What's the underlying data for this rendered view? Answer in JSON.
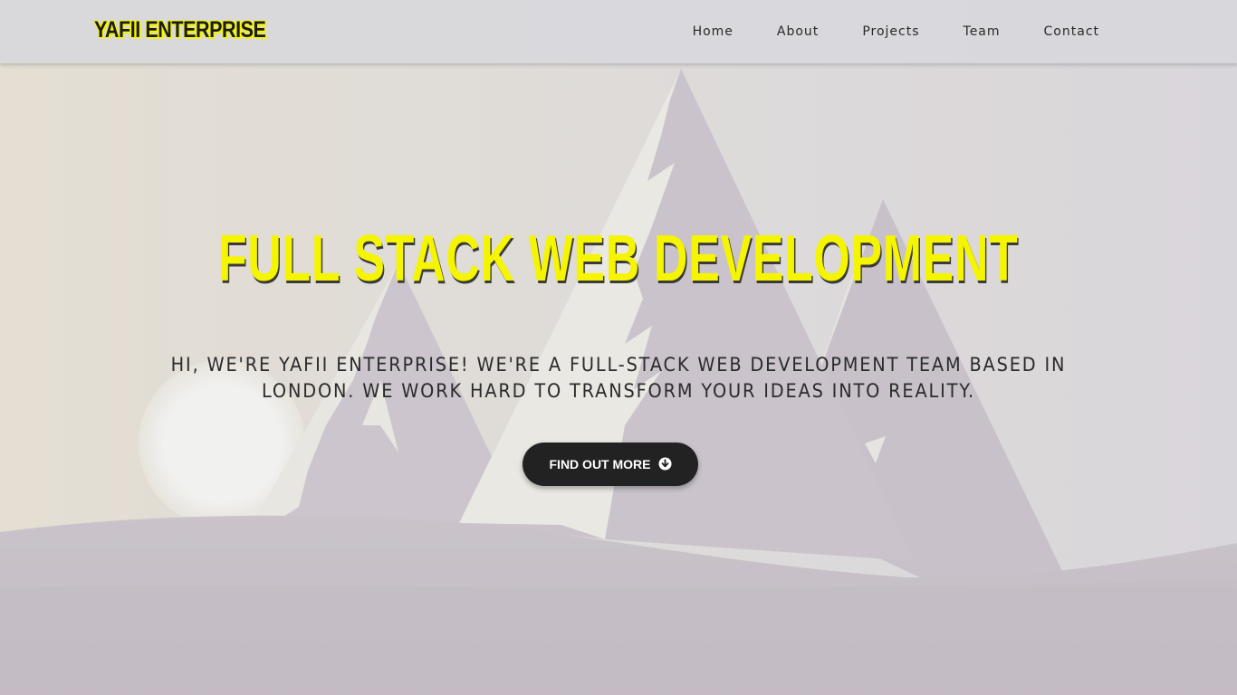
{
  "brand": {
    "name": "YAFII ENTERPRISE"
  },
  "nav": {
    "items": [
      {
        "label": "Home"
      },
      {
        "label": "About"
      },
      {
        "label": "Projects"
      },
      {
        "label": "Team"
      },
      {
        "label": "Contact"
      }
    ]
  },
  "hero": {
    "title": "FULL STACK WEB DEVELOPMENT",
    "subtitle": "HI, WE'RE YAFII ENTERPRISE! WE'RE A FULL-STACK WEB DEVELOPMENT TEAM BASED IN LONDON. WE WORK HARD TO TRANSFORM YOUR IDEAS INTO REALITY.",
    "cta_label": "FIND OUT MORE",
    "cta_icon": "arrow-circle-down-icon"
  },
  "colors": {
    "accent_yellow": "#f5f500",
    "button_dark": "#222222",
    "mountain": "#c4bcc6",
    "snow": "#e8e6e2",
    "sun": "#ececec"
  }
}
